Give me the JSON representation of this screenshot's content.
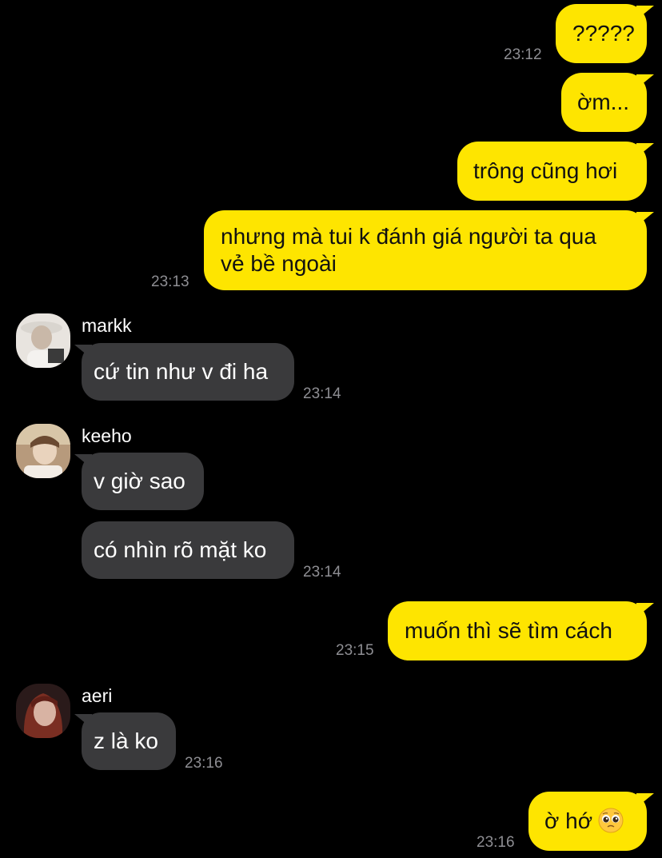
{
  "colors": {
    "background": "#000000",
    "outgoing_bubble": "#FEE500",
    "incoming_bubble": "#3A3A3C",
    "timestamp": "#8E8E93"
  },
  "messages": {
    "m1": {
      "text": "?????",
      "time": "23:12"
    },
    "m2": {
      "text": "ờm..."
    },
    "m3": {
      "text": "trông cũng hơi"
    },
    "m4": {
      "line1": "nhưng mà tui k đánh giá người ta qua",
      "line2": "vẻ bề ngoài",
      "time": "23:13"
    },
    "m5": {
      "sender": "markk",
      "text": "cứ tin như v đi ha",
      "time": "23:14",
      "avatar_icon": "profile-photo-icon"
    },
    "m6": {
      "sender": "keeho",
      "text": "v giờ sao",
      "avatar_icon": "profile-photo-icon"
    },
    "m7": {
      "text": "có nhìn rõ mặt ko",
      "time": "23:14"
    },
    "m8": {
      "text": "muốn thì sẽ tìm cách",
      "time": "23:15"
    },
    "m9": {
      "sender": "aeri",
      "text": "z là ko",
      "time": "23:16",
      "avatar_icon": "profile-photo-icon"
    },
    "m10": {
      "text": "ờ hớ",
      "emoji": "pleading-face-icon",
      "time": "23:16"
    }
  }
}
